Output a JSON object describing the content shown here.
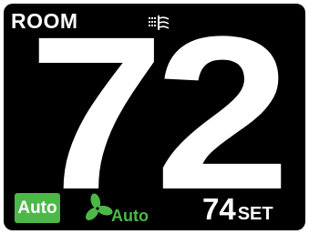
{
  "header": {
    "room_label": "ROOM",
    "ventilation_icon": "ventilation-icon"
  },
  "display": {
    "temperature": "72"
  },
  "controls": {
    "mode_label": "Auto",
    "fan_icon": "fan-icon",
    "fan_label": "Auto",
    "setpoint_value": "74",
    "setpoint_unit": "SET"
  },
  "colors": {
    "screen_background": "#000000",
    "text": "#ffffff",
    "accent_green": "#4cb848"
  }
}
